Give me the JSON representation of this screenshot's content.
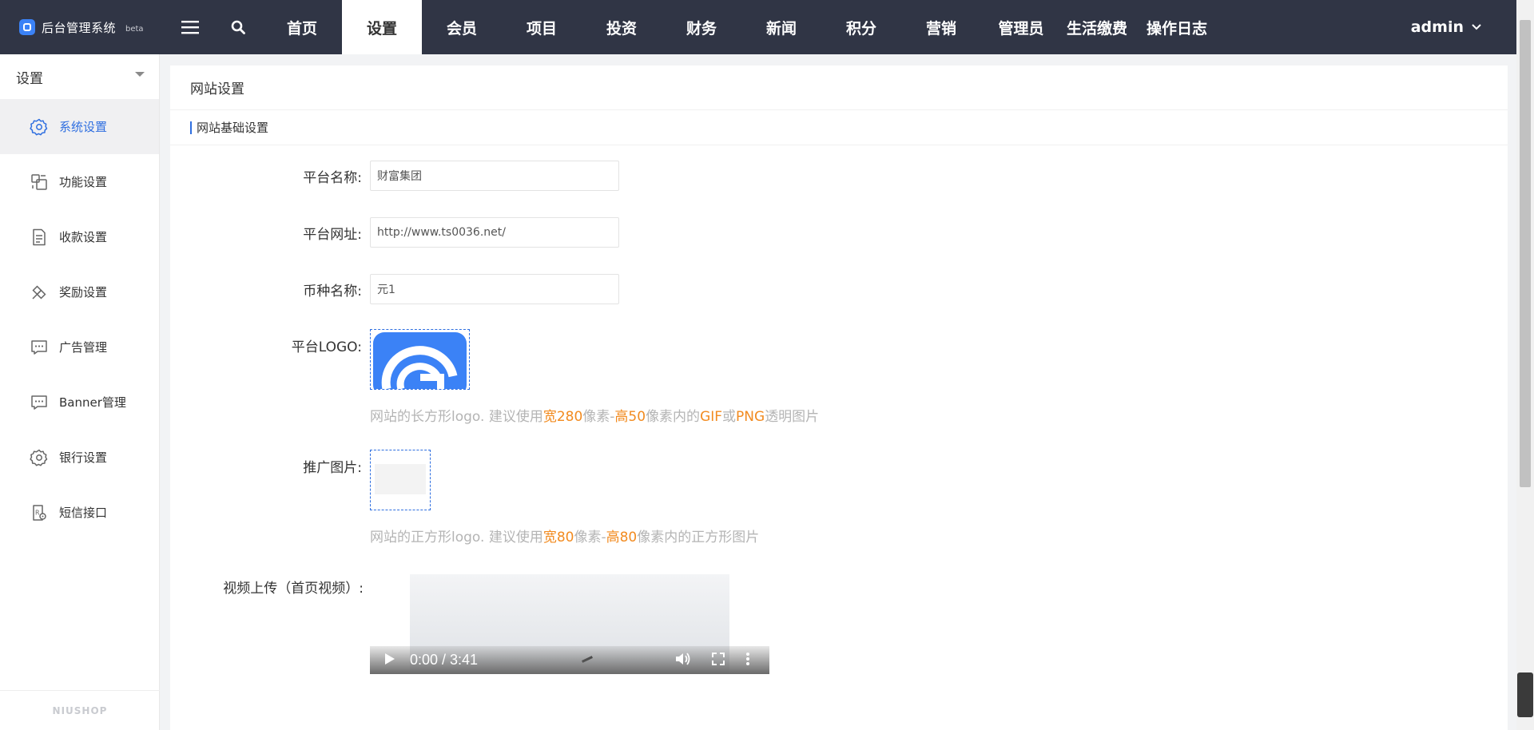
{
  "brand": {
    "name": "后台管理系统",
    "beta": "beta"
  },
  "nav": {
    "items": [
      "首页",
      "设置",
      "会员",
      "项目",
      "投资",
      "财务",
      "新闻",
      "积分",
      "营销",
      "管理员",
      "生活缴费",
      "操作日志"
    ],
    "active": "设置"
  },
  "user": {
    "name": "admin"
  },
  "sidebar": {
    "header": "设置",
    "items": [
      {
        "label": "系统设置",
        "icon": "gear-icon",
        "active": true
      },
      {
        "label": "功能设置",
        "icon": "function-icon"
      },
      {
        "label": "收款设置",
        "icon": "document-icon"
      },
      {
        "label": "奖励设置",
        "icon": "gift-icon"
      },
      {
        "label": "广告管理",
        "icon": "chat-icon"
      },
      {
        "label": "Banner管理",
        "icon": "chat-icon"
      },
      {
        "label": "银行设置",
        "icon": "gear-icon"
      },
      {
        "label": "短信接口",
        "icon": "sms-icon"
      }
    ],
    "footer": "NIUSHOP"
  },
  "page": {
    "title": "网站设置",
    "section": "网站基础设置",
    "fields": {
      "platform_name": {
        "label": "平台名称:",
        "value": "财富集团"
      },
      "platform_url": {
        "label": "平台网址:",
        "value": "http://www.ts0036.net/"
      },
      "currency_name": {
        "label": "币种名称:",
        "value": "元1"
      },
      "logo": {
        "label": "平台LOGO:",
        "hint": {
          "p1": "网站的长方形logo. 建议使用",
          "w": "宽280",
          "p2": "像素-",
          "h": "高50",
          "p3": "像素内的",
          "f1": "GIF",
          "p4": "或",
          "f2": "PNG",
          "p5": "透明图片"
        }
      },
      "promo_image": {
        "label": "推广图片:",
        "hint": {
          "p1": "网站的正方形logo. 建议使用",
          "w": "宽80",
          "p2": "像素-",
          "h": "高80",
          "p3": "像素内的正方形图片"
        }
      },
      "video": {
        "label": "视频上传（首页视频）:",
        "time": "0:00 / 3:41"
      }
    }
  },
  "colors": {
    "topbar": "#303545",
    "accent": "#2f6fe0",
    "highlight": "#f28b20",
    "logo_blue": "#3b82f6"
  }
}
